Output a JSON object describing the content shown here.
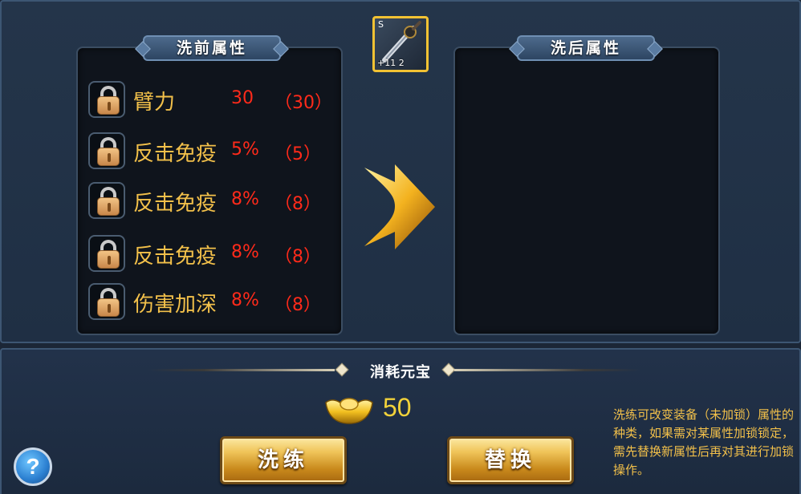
{
  "panels": {
    "before_title": "洗前属性",
    "after_title": "洗后属性"
  },
  "item": {
    "grade": "S",
    "level": "+11 2",
    "icon": "sword-icon"
  },
  "attributes": [
    {
      "name": "臂力",
      "value": "30",
      "paren": "（30）",
      "locked": false
    },
    {
      "name": "反击免疫",
      "value": "5%",
      "paren": "（5）",
      "locked": false
    },
    {
      "name": "反击免疫",
      "value": "8%",
      "paren": "（8）",
      "locked": false
    },
    {
      "name": "反击免疫",
      "value": "8%",
      "paren": "（8）",
      "locked": false
    },
    {
      "name": "伤害加深",
      "value": "8%",
      "paren": "（8）",
      "locked": false
    }
  ],
  "cost": {
    "title": "消耗元宝",
    "amount": "50",
    "icon": "gold-ingot-icon"
  },
  "buttons": {
    "wash": "洗练",
    "replace": "替换",
    "help": "?"
  },
  "hint": "洗练可改变装备（未加锁）属性的种类，如果需对某属性加锁锁定，需先替换新属性后再对其进行加锁操作。",
  "colors": {
    "attr_name": "#f2c04a",
    "attr_value": "#ff2a1a",
    "cost_value": "#f2d23a",
    "panel_bg": "#0f141c"
  }
}
